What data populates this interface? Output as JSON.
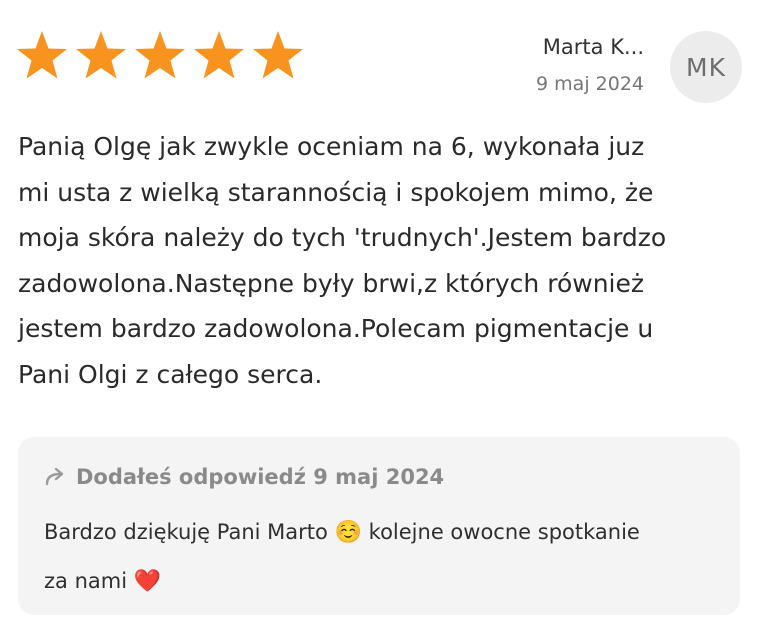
{
  "review": {
    "rating": 5,
    "rating_max": 5,
    "star_color": "#F7931E",
    "star_icon": "star-icon",
    "author": {
      "name": "Marta K...",
      "initials": "MK",
      "date": "9 maj 2024"
    },
    "text_lines": [
      "Panią Olgę jak zwykle oceniam na 6, wykonała juz",
      "mi usta z wielką starannością i spokojem mimo, że",
      "moja skóra należy do tych 'trudnych'.Jestem bardzo",
      "zadowolona.Następne były brwi,z których również",
      "jestem bardzo zadowolona.Polecam pigmentacje u",
      "Pani Olgi z całego serca."
    ]
  },
  "reply": {
    "icon": "reply-arrow-icon",
    "header": "Dodałeś odpowiedź 9 maj 2024",
    "line1_before": "Bardzo dziękuję Pani Marto",
    "line1_emoji": "☺️",
    "line1_after": "kolejne owocne spotkanie",
    "line2_text": "za nami",
    "line2_emoji": "❤️"
  }
}
